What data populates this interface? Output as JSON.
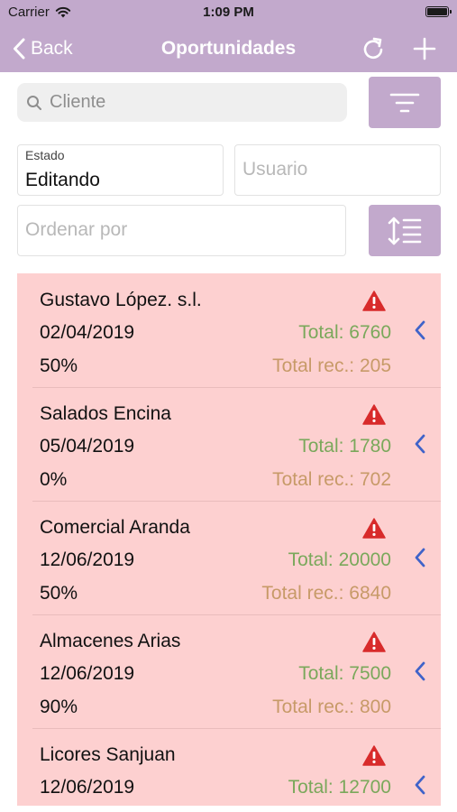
{
  "status_bar": {
    "carrier": "Carrier",
    "time": "1:09 PM"
  },
  "nav": {
    "back_label": "Back",
    "title": "Oportunidades"
  },
  "search": {
    "placeholder": "Cliente",
    "value": ""
  },
  "filters": {
    "estado_label": "Estado",
    "estado_value": "Editando",
    "usuario_placeholder": "Usuario",
    "ordenar_placeholder": "Ordenar por"
  },
  "colors": {
    "accent": "#c2a9cc",
    "row_background": "#fdd0d0",
    "total_text": "#7aa85b",
    "total_rec_text": "#c79a68",
    "warning": "#d82b2b",
    "chevron": "#3f63c9"
  },
  "icons": {
    "back": "chevron-left-icon",
    "refresh": "refresh-icon",
    "add": "plus-icon",
    "search": "search-icon",
    "filter": "filter-icon",
    "sort": "sort-icon",
    "warning": "warning-icon",
    "row_chevron": "chevron-left-icon"
  },
  "opportunities": [
    {
      "name": "Gustavo López. s.l.",
      "date": "02/04/2019",
      "percent": "50%",
      "total": "Total: 6760",
      "total_rec": "Total rec.: 205"
    },
    {
      "name": "Salados Encina",
      "date": "05/04/2019",
      "percent": "0%",
      "total": "Total: 1780",
      "total_rec": "Total rec.: 702"
    },
    {
      "name": "Comercial Aranda",
      "date": "12/06/2019",
      "percent": "50%",
      "total": "Total: 20000",
      "total_rec": "Total rec.: 6840"
    },
    {
      "name": "Almacenes Arias",
      "date": "12/06/2019",
      "percent": "90%",
      "total": "Total: 7500",
      "total_rec": "Total rec.: 800"
    },
    {
      "name": "Licores Sanjuan",
      "date": "12/06/2019",
      "percent": "",
      "total": "Total: 12700",
      "total_rec": ""
    }
  ]
}
